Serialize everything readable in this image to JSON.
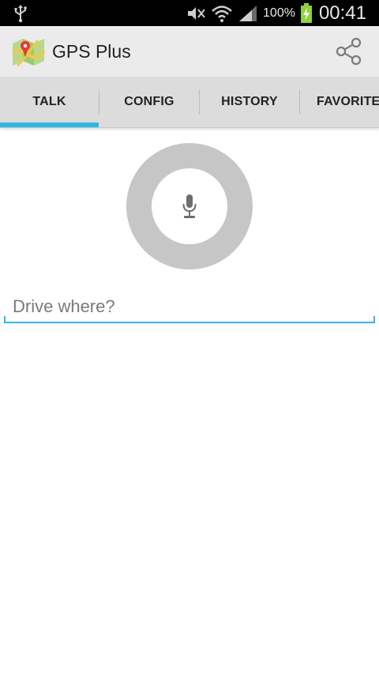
{
  "status_bar": {
    "battery_percent": "100%",
    "time": "00:41",
    "icons": [
      "usb-icon",
      "mute-icon",
      "wifi-icon",
      "signal-icon",
      "battery-charging-icon"
    ]
  },
  "action_bar": {
    "title": "GPS Plus",
    "icon": "app-map-icon",
    "share_icon": "share-icon"
  },
  "tabs": [
    {
      "label": "TALK",
      "selected": true
    },
    {
      "label": "CONFIG",
      "selected": false
    },
    {
      "label": "HISTORY",
      "selected": false
    },
    {
      "label": "FAVORITES",
      "selected": false
    }
  ],
  "voice": {
    "icon": "microphone-icon"
  },
  "search": {
    "placeholder": "Drive where?",
    "value": ""
  },
  "colors": {
    "accent": "#33b5e5",
    "tab_bar": "#dcdcdc",
    "action_bar": "#ebebeb",
    "mic_ring": "#c6c6c6"
  }
}
